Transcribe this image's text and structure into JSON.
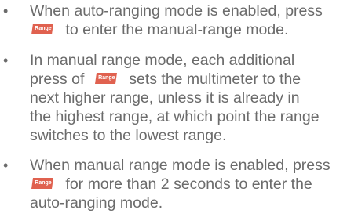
{
  "bullet_char": "•",
  "accent_color": "#e0614f",
  "button_label": "Range",
  "items": [
    {
      "line1_before": "When auto-ranging mode is enabled, press",
      "line2_after": "to enter the manual-range mode."
    },
    {
      "line1": "In manual range mode, each additional",
      "line2_before": "press of",
      "line2_after": "sets the multimeter to the",
      "line3": "next higher range, unless it is already in",
      "line4": "the highest range, at which point the range",
      "line5": "switches to the lowest range."
    },
    {
      "line1": "When manual range mode is enabled, press",
      "line2_after": "for more than 2 seconds to enter the",
      "line3": "auto-ranging mode."
    }
  ]
}
